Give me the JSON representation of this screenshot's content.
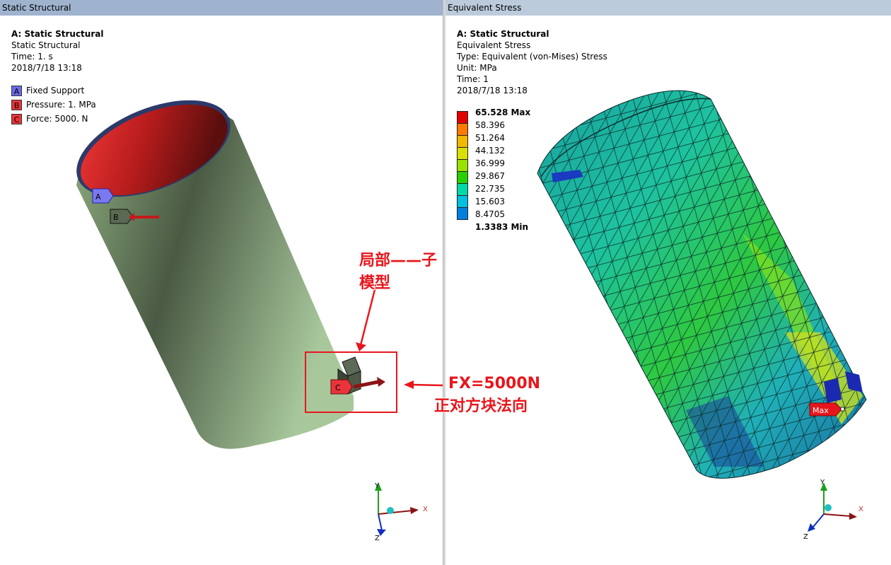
{
  "left_pane": {
    "header": "Static Structural",
    "info": {
      "title": "A: Static Structural",
      "line1": "Static Structural",
      "line2": "Time: 1. s",
      "line3": "2018/7/18 13:18"
    },
    "boundary_conditions": [
      {
        "letter": "A",
        "label": "Fixed Support",
        "color": "#6a6ae8"
      },
      {
        "letter": "B",
        "label": "Pressure: 1. MPa",
        "color": "#e8343a"
      },
      {
        "letter": "C",
        "label": "Force: 5000. N",
        "color": "#e8343a"
      }
    ],
    "markers": {
      "a": "A",
      "b": "B",
      "c": "C"
    }
  },
  "right_pane": {
    "header": "Equivalent Stress",
    "info": {
      "title": "A: Static Structural",
      "line1": "Equivalent Stress",
      "line2": "Type: Equivalent (von-Mises) Stress",
      "line3": "Unit: MPa",
      "line4": "Time: 1",
      "line5": "2018/7/18 13:18"
    },
    "scale": {
      "labels": [
        "65.528 Max",
        "58.396",
        "51.264",
        "44.132",
        "36.999",
        "29.867",
        "22.735",
        "15.603",
        "8.4705",
        "1.3383 Min"
      ],
      "colors": [
        "#e00000",
        "#ff7a00",
        "#f0b800",
        "#d8e000",
        "#9ae000",
        "#28d000",
        "#00d8a8",
        "#00c0e0",
        "#0080e0",
        "#0010e0"
      ]
    },
    "max_label": "Max"
  },
  "annotations": {
    "submodel": "局部——子模型",
    "force_line1": "FX=5000N",
    "force_line2": "正对方块法向"
  },
  "triad": {
    "x": "X",
    "y": "Y",
    "z": "Z"
  }
}
